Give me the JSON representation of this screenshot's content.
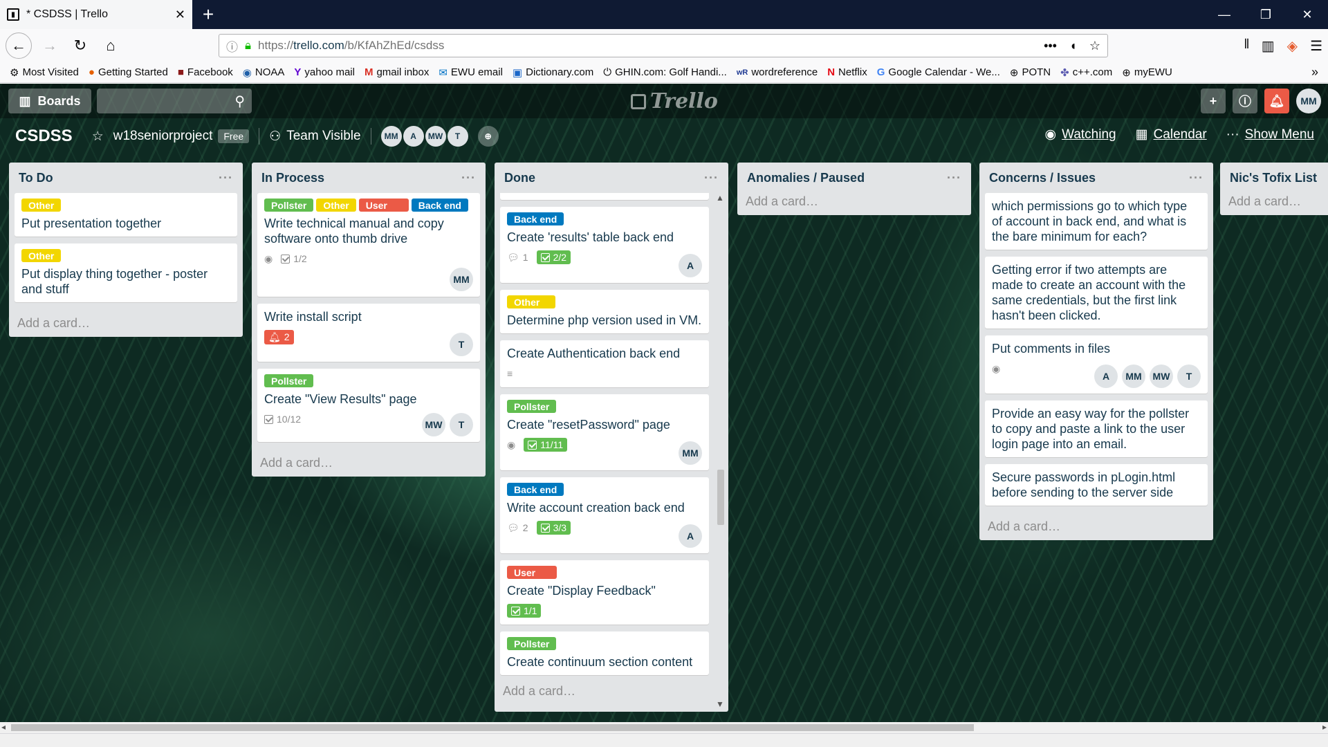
{
  "browser": {
    "tab_title": "* CSDSS | Trello",
    "url_scheme": "https://",
    "url_host": "trello.com",
    "url_path": "/b/KfAhZhEd/csdss",
    "bookmarks": [
      "Most Visited",
      "Getting Started",
      "Facebook",
      "NOAA",
      "yahoo mail",
      "gmail inbox",
      "EWU email",
      "Dictionary.com",
      "GHIN.com: Golf Handi...",
      "wordreference",
      "Netflix",
      "Google Calendar - We...",
      "POTN",
      "c++.com",
      "myEWU"
    ]
  },
  "header": {
    "boards_label": "Boards",
    "logo_text": "Trello",
    "user_initials": "MM"
  },
  "board": {
    "name": "CSDSS",
    "team": "w18seniorproject",
    "plan": "Free",
    "visibility": "Team Visible",
    "members": [
      "MM",
      "A",
      "MW",
      "T"
    ],
    "watching": "Watching",
    "calendar": "Calendar",
    "show_menu": "Show Menu"
  },
  "lists": {
    "todo": {
      "title": "To Do",
      "add": "Add a card…",
      "cards": [
        {
          "label": "Other",
          "title": "Put presentation together"
        },
        {
          "label": "Other",
          "title": "Put display thing together - poster and stuff"
        }
      ]
    },
    "inprocess": {
      "title": "In Process",
      "add": "Add a card…",
      "c1": {
        "labels": [
          "Pollster",
          "Other",
          "User",
          "Back end"
        ],
        "title": "Write technical manual and copy software onto thumb drive",
        "checklist": "1/2",
        "member": "MM"
      },
      "c2": {
        "title": "Write install script",
        "due": "2",
        "member": "T"
      },
      "c3": {
        "label": "Pollster",
        "title": "Create \"View Results\" page",
        "checklist": "10/12",
        "members": [
          "MW",
          "T"
        ]
      }
    },
    "done": {
      "title": "Done",
      "add": "Add a card…",
      "c1": {
        "label": "Back end",
        "title": "Create 'results' table back end",
        "comments": "1",
        "checklist": "2/2",
        "member": "A"
      },
      "c2": {
        "label": "Other",
        "title": "Determine php version used in VM."
      },
      "c3": {
        "title": "Create Authentication back end"
      },
      "c4": {
        "label": "Pollster",
        "title": "Create \"resetPassword\" page",
        "checklist": "11/11",
        "member": "MM"
      },
      "c5": {
        "label": "Back end",
        "title": "Write account creation back end",
        "comments": "2",
        "checklist": "3/3",
        "member": "A"
      },
      "c6": {
        "label": "User",
        "title": "Create \"Display Feedback\"",
        "checklist": "1/1"
      },
      "c7": {
        "label": "Pollster",
        "title": "Create continuum section content"
      }
    },
    "anomalies": {
      "title": "Anomalies / Paused",
      "add": "Add a card…"
    },
    "concerns": {
      "title": "Concerns / Issues",
      "add": "Add a card…",
      "cards": [
        "which permissions go to which type of account in back end, and what is the bare minimum for each?",
        "Getting error if two attempts are made to create an account with the same credentials, but the first link hasn't been clicked.",
        "Put comments in files",
        "Provide an easy way for the pollster to copy and paste a link to the user login page into an email.",
        "Secure passwords in pLogin.html before sending to the server side"
      ],
      "members": [
        "A",
        "MM",
        "MW",
        "T"
      ]
    },
    "tofix": {
      "title": "Nic's Tofix List",
      "add": "Add a card…"
    }
  },
  "colors": {
    "green": "#61bd4f",
    "yellow": "#f2d600",
    "red": "#eb5a46",
    "blue": "#0079bf"
  }
}
